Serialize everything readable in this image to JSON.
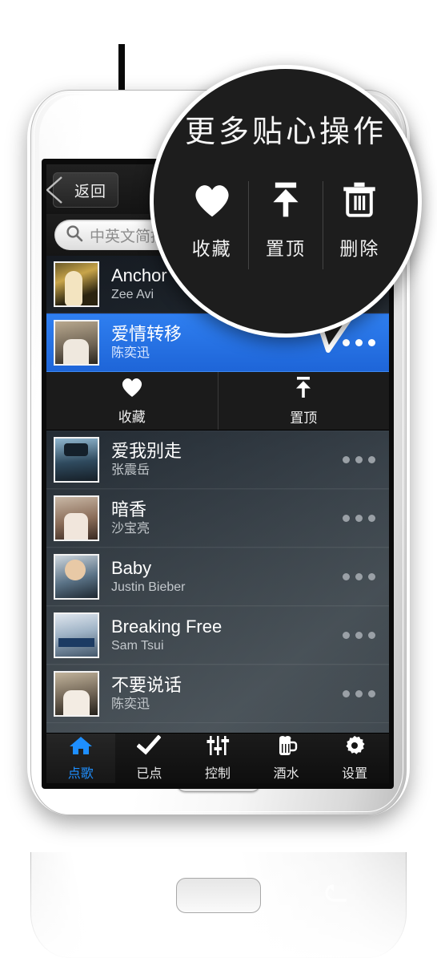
{
  "app": {
    "name": "KTV song ordering app",
    "accent_blue": "#2f7ff0",
    "tab_active_color": "#1e8fff",
    "screen_bg": "#101010"
  },
  "appbar": {
    "back_label": "返回",
    "back_icon": "chevron-left-icon"
  },
  "search": {
    "icon": "search-icon",
    "placeholder": "中英文简拼搜索",
    "value": ""
  },
  "songs": [
    {
      "title": "Anchor",
      "artist": "Zee Avi",
      "selected": false,
      "more_icon": "more-dots-icon",
      "art": "art1"
    },
    {
      "title": "爱情转移",
      "artist": "陈奕迅",
      "selected": true,
      "more_icon": "more-dots-icon",
      "art": "art2"
    },
    {
      "title": "爱我别走",
      "artist": "张震岳",
      "selected": false,
      "more_icon": "more-dots-icon",
      "art": "art3"
    },
    {
      "title": "暗香",
      "artist": "沙宝亮",
      "selected": false,
      "more_icon": "more-dots-icon",
      "art": "art4"
    },
    {
      "title": "Baby",
      "artist": "Justin Bieber",
      "selected": false,
      "more_icon": "more-dots-icon",
      "art": "art5"
    },
    {
      "title": "Breaking Free",
      "artist": "Sam Tsui",
      "selected": false,
      "more_icon": "more-dots-icon",
      "art": "art6"
    },
    {
      "title": "不要说话",
      "artist": "陈奕迅",
      "selected": false,
      "more_icon": "more-dots-icon",
      "art": "art7"
    }
  ],
  "row_actions": [
    {
      "label": "收藏",
      "icon": "heart-icon"
    },
    {
      "label": "置顶",
      "icon": "pin-to-top-icon"
    }
  ],
  "tabs": [
    {
      "label": "点歌",
      "icon": "home-icon",
      "active": true
    },
    {
      "label": "已点",
      "icon": "check-icon",
      "active": false
    },
    {
      "label": "控制",
      "icon": "sliders-icon",
      "active": false
    },
    {
      "label": "酒水",
      "icon": "beer-mug-icon",
      "active": false
    },
    {
      "label": "设置",
      "icon": "gear-icon",
      "active": false
    }
  ],
  "hardware": {
    "menu_icon": "menu-icon",
    "home_button": "home-button",
    "back_icon": "back-arrow-icon"
  },
  "callout": {
    "title": "更多贴心操作",
    "actions": [
      {
        "label": "收藏",
        "icon": "heart-icon"
      },
      {
        "label": "置顶",
        "icon": "pin-to-top-icon"
      },
      {
        "label": "删除",
        "icon": "trash-icon"
      }
    ]
  }
}
